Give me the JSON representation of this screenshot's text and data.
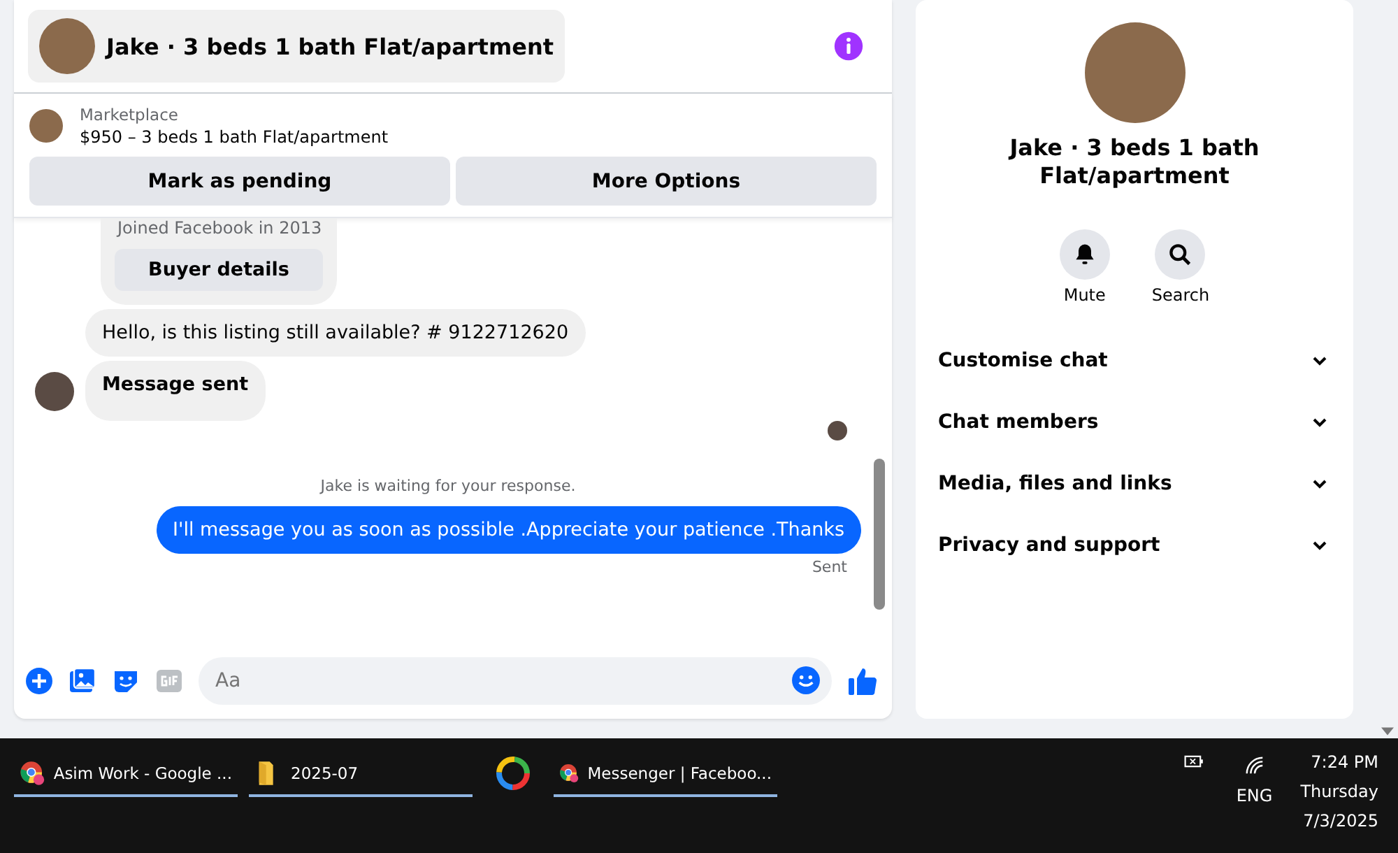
{
  "chat": {
    "title": "Jake · 3 beds 1 bath Flat/apartment",
    "listing": {
      "source": "Marketplace",
      "summary": "$950 – 3 beds 1 bath Flat/apartment"
    },
    "actions": [
      "Mark as pending",
      "More Options"
    ],
    "buyer_card": {
      "joined": "Joined Facebook in 2013",
      "button": "Buyer details"
    },
    "messages": [
      {
        "kind": "incoming",
        "text": "Hello, is this listing still available? # 9122712620",
        "bold": false,
        "avatar": false
      },
      {
        "kind": "incoming",
        "text": "Message sent",
        "bold": true,
        "avatar": true
      }
    ],
    "notice": "Jake is waiting for your response.",
    "outgoing": {
      "text": "I'll message you as soon as possible .Appreciate your patience .Thanks",
      "status": "Sent"
    },
    "composer": {
      "placeholder": "Aa"
    }
  },
  "details": {
    "title": "Jake · 3 beds 1 bath Flat/apartment",
    "quick_actions": [
      {
        "kind": "mute",
        "label": "Mute"
      },
      {
        "kind": "search",
        "label": "Search"
      }
    ],
    "sections": [
      {
        "label": "Customise chat",
        "expanded": false
      },
      {
        "label": "Chat members",
        "expanded": false
      },
      {
        "label": "Media, files and links",
        "expanded": false
      },
      {
        "label": "Privacy and support",
        "expanded": false
      }
    ]
  },
  "taskbar": {
    "apps": [
      {
        "kind": "chrome",
        "label": "Asim Work - Google ...",
        "open": true
      },
      {
        "kind": "folder",
        "label": "2025-07",
        "open": true
      },
      {
        "kind": "photos",
        "open": false
      },
      {
        "kind": "chrome",
        "label": "Messenger | Faceboo...",
        "open": true
      }
    ],
    "language": "ENG",
    "time": "7:24 PM",
    "day": "Thursday",
    "date": "7/3/2025"
  }
}
